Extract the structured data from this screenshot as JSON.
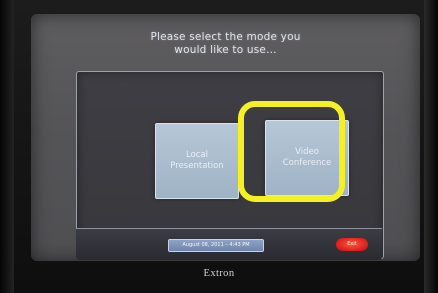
{
  "screen": {
    "title": "Please select the mode you\nwould like to use..."
  },
  "modes": {
    "local_label": "Local\nPresentation",
    "video_label": "Video\nConference"
  },
  "footer": {
    "datetime": "August 08, 2011 – 4:43 PM",
    "exit_label": "Exit"
  },
  "device": {
    "brand": "Extron"
  },
  "colors": {
    "highlight": "#f5f023",
    "mode_button": "#a9bccf",
    "exit_button": "#d91e1e"
  }
}
